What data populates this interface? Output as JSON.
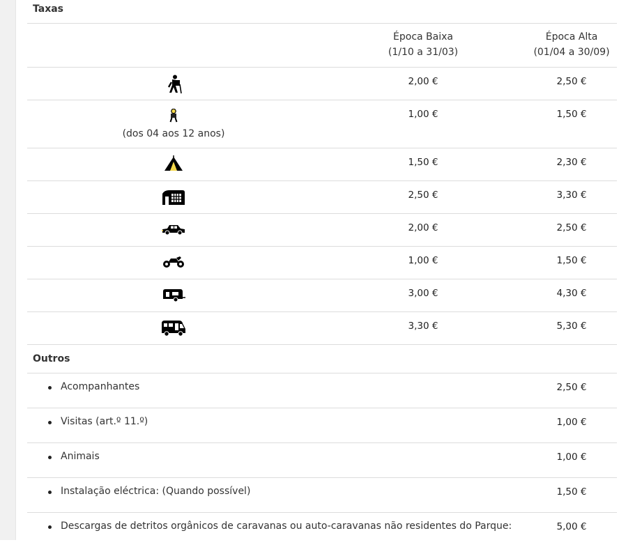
{
  "section_title": "Taxas",
  "header": {
    "low_season": "Época Baixa",
    "low_season_dates": "(1/10 a 31/03)",
    "high_season": "Época Alta",
    "high_season_dates": "(01/04 a 30/09)"
  },
  "rates": [
    {
      "icon": "hiker-icon",
      "low": "2,00 €",
      "high": "2,50 €"
    },
    {
      "icon": "child-icon",
      "subtitle": "(dos 04 aos 12 anos)",
      "low": "1,00 €",
      "high": "1,50 €"
    },
    {
      "icon": "tent-icon",
      "low": "1,50 €",
      "high": "2,30 €"
    },
    {
      "icon": "large-tent-icon",
      "low": "2,50 €",
      "high": "3,30 €"
    },
    {
      "icon": "car-icon",
      "low": "2,00 €",
      "high": "2,50 €"
    },
    {
      "icon": "motorcycle-icon",
      "low": "1,00 €",
      "high": "1,50 €"
    },
    {
      "icon": "caravan-icon",
      "low": "3,00 €",
      "high": "4,30 €"
    },
    {
      "icon": "motorhome-icon",
      "low": "3,30 €",
      "high": "5,30 €"
    }
  ],
  "outros": {
    "title": "Outros",
    "items": [
      {
        "label": "Acompanhantes",
        "price": "2,50 €"
      },
      {
        "label": "Visitas (art.º 11.º)",
        "price": "1,00 €"
      },
      {
        "label": "Animais",
        "price": "1,00 €"
      },
      {
        "label": "Instalação eléctrica: (Quando possível)",
        "price": "1,50 €"
      },
      {
        "label": "Descargas de detritos orgânicos de caravanas ou auto-caravanas não residentes do Parque:",
        "price": "5,00 €"
      }
    ]
  }
}
